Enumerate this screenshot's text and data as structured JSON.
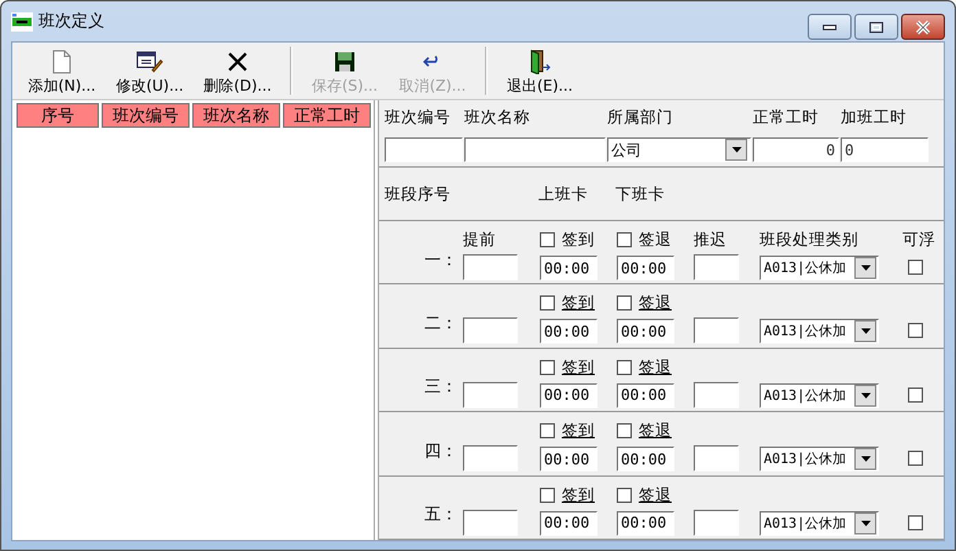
{
  "window": {
    "title": "班次定义"
  },
  "toolbar": [
    {
      "label": "添加(N)...",
      "kind": "add",
      "disabled": false
    },
    {
      "label": "修改(U)...",
      "kind": "edit",
      "disabled": false
    },
    {
      "label": "删除(D)...",
      "kind": "delete",
      "disabled": false
    },
    {
      "label": "保存(S)...",
      "kind": "save",
      "disabled": true
    },
    {
      "label": "取消(Z)...",
      "kind": "cancel",
      "disabled": true
    },
    {
      "label": "退出(E)...",
      "kind": "exit",
      "disabled": false
    }
  ],
  "list": {
    "columns": [
      "序号",
      "班次编号",
      "班次名称",
      "正常工时"
    ]
  },
  "form": {
    "fields": [
      {
        "label": "班次编号",
        "kind": "text"
      },
      {
        "label": "班次名称",
        "kind": "text"
      },
      {
        "label": "所属部门",
        "kind": "select",
        "value": "公司"
      },
      {
        "label": "正常工时",
        "kind": "number",
        "value": "0"
      },
      {
        "label": "加班工时",
        "kind": "text",
        "value": "0"
      }
    ],
    "segment_header": {
      "number": "班段序号",
      "checkin": "上班卡",
      "checkout": "下班卡"
    },
    "segment_columns": {
      "early": "提前",
      "late": "推迟",
      "category": "班段处理类别",
      "floating": "可浮"
    },
    "segments": [
      {
        "name": "一：",
        "checkin": {
          "label": "签到",
          "checked": false,
          "time": "00:00"
        },
        "checkout": {
          "label": "签退",
          "checked": false,
          "time": "00:00"
        },
        "category": "A013|公休加",
        "floating": false
      },
      {
        "name": "二：",
        "checkin": {
          "label": "签到",
          "checked": false,
          "time": "00:00"
        },
        "checkout": {
          "label": "签退",
          "checked": false,
          "time": "00:00"
        },
        "category": "A013|公休加",
        "floating": false
      },
      {
        "name": "三：",
        "checkin": {
          "label": "签到",
          "checked": false,
          "time": "00:00"
        },
        "checkout": {
          "label": "签退",
          "checked": false,
          "time": "00:00"
        },
        "category": "A013|公休加",
        "floating": false
      },
      {
        "name": "四：",
        "checkin": {
          "label": "签到",
          "checked": false,
          "time": "00:00"
        },
        "checkout": {
          "label": "签退",
          "checked": false,
          "time": "00:00"
        },
        "category": "A013|公休加",
        "floating": false
      },
      {
        "name": "五：",
        "checkin": {
          "label": "签到",
          "checked": false,
          "time": "00:00"
        },
        "checkout": {
          "label": "签退",
          "checked": false,
          "time": "00:00"
        },
        "category": "A013|公休加",
        "floating": false
      }
    ]
  }
}
